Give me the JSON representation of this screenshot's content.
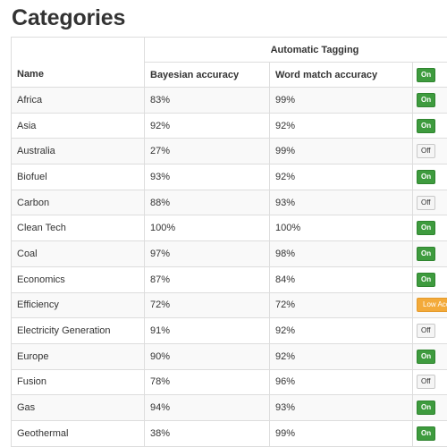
{
  "page": {
    "title": "Categories"
  },
  "table": {
    "group_header": "Automatic Tagging",
    "columns": {
      "name": "Name",
      "bayesian": "Bayesian accuracy",
      "word_match": "Word match accuracy"
    },
    "header_toggle": {
      "label": "On",
      "state": "on"
    },
    "rows": [
      {
        "name": "Africa",
        "bayesian": "83%",
        "word_match": "99%",
        "tag": {
          "label": "On",
          "state": "on"
        }
      },
      {
        "name": "Asia",
        "bayesian": "92%",
        "word_match": "92%",
        "tag": {
          "label": "On",
          "state": "on"
        }
      },
      {
        "name": "Australia",
        "bayesian": "27%",
        "word_match": "99%",
        "tag": {
          "label": "Off",
          "state": "off"
        }
      },
      {
        "name": "Biofuel",
        "bayesian": "93%",
        "word_match": "92%",
        "tag": {
          "label": "On",
          "state": "on"
        }
      },
      {
        "name": "Carbon",
        "bayesian": "88%",
        "word_match": "93%",
        "tag": {
          "label": "Off",
          "state": "off"
        }
      },
      {
        "name": "Clean Tech",
        "bayesian": "100%",
        "word_match": "100%",
        "tag": {
          "label": "On",
          "state": "on"
        }
      },
      {
        "name": "Coal",
        "bayesian": "97%",
        "word_match": "98%",
        "tag": {
          "label": "On",
          "state": "on"
        }
      },
      {
        "name": "Economics",
        "bayesian": "87%",
        "word_match": "84%",
        "tag": {
          "label": "On",
          "state": "on"
        }
      },
      {
        "name": "Efficiency",
        "bayesian": "72%",
        "word_match": "72%",
        "tag": {
          "label": "Low Accuracy",
          "state": "low"
        }
      },
      {
        "name": "Electricity Generation",
        "bayesian": "91%",
        "word_match": "92%",
        "tag": {
          "label": "Off",
          "state": "off"
        }
      },
      {
        "name": "Europe",
        "bayesian": "90%",
        "word_match": "92%",
        "tag": {
          "label": "On",
          "state": "on"
        }
      },
      {
        "name": "Fusion",
        "bayesian": "78%",
        "word_match": "96%",
        "tag": {
          "label": "Off",
          "state": "off"
        }
      },
      {
        "name": "Gas",
        "bayesian": "94%",
        "word_match": "93%",
        "tag": {
          "label": "On",
          "state": "on"
        }
      },
      {
        "name": "Geothermal",
        "bayesian": "38%",
        "word_match": "99%",
        "tag": {
          "label": "On",
          "state": "on"
        }
      }
    ]
  },
  "colors": {
    "on": "#3e9b3e",
    "off": "#f5f5f5",
    "low": "#f3aa3a",
    "border": "#dddddd",
    "stripe": "#f9f9f9"
  }
}
